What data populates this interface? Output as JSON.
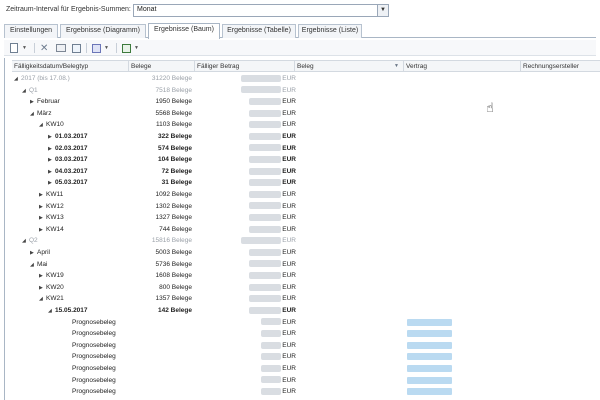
{
  "interval": {
    "label": "Zeitraum-Interval für Ergebnis-Summen:",
    "value": "Monat"
  },
  "tabs": [
    {
      "label": "Einstellungen",
      "active": false
    },
    {
      "label": "Ergebnisse (Diagramm)",
      "active": false
    },
    {
      "label": "Ergebnisse (Baum)",
      "active": true
    },
    {
      "label": "Ergebnisse (Tabelle)",
      "active": false
    },
    {
      "label": "Ergebnisse (Liste)",
      "active": false
    }
  ],
  "toolbar": {
    "icons": [
      "new-document-icon",
      "dropdown-icon",
      "delete-icon",
      "book-icon",
      "page-icon",
      "save-icon",
      "dropdown-icon",
      "export-icon",
      "dropdown-icon"
    ]
  },
  "columns": [
    "Fälligkeitsdatum/Belegtyp",
    "Belege",
    "Fälliger Betrag",
    "Beleg",
    "Vertrag",
    "Rechnungsersteller"
  ],
  "currency": "EUR",
  "rows": [
    {
      "label": "2017 (bis 17.08.)",
      "belege": "31220 Belege",
      "amount": true,
      "level": 0,
      "expanded": true,
      "grey": true
    },
    {
      "label": "Q1",
      "belege": "7518 Belege",
      "amount": true,
      "level": 1,
      "expanded": true,
      "grey": true
    },
    {
      "label": "Februar",
      "belege": "1950 Belege",
      "amount": true,
      "level": 2,
      "expanded": false
    },
    {
      "label": "März",
      "belege": "5568 Belege",
      "amount": true,
      "level": 2,
      "expanded": true
    },
    {
      "label": "KW10",
      "belege": "1103 Belege",
      "amount": true,
      "level": 3,
      "expanded": true
    },
    {
      "label": "01.03.2017",
      "belege": "322 Belege",
      "amount": true,
      "level": 4,
      "expanded": false,
      "bold": true
    },
    {
      "label": "02.03.2017",
      "belege": "574 Belege",
      "amount": true,
      "level": 4,
      "expanded": false,
      "bold": true
    },
    {
      "label": "03.03.2017",
      "belege": "104 Belege",
      "amount": true,
      "level": 4,
      "expanded": false,
      "bold": true
    },
    {
      "label": "04.03.2017",
      "belege": "72 Belege",
      "amount": true,
      "level": 4,
      "expanded": false,
      "bold": true
    },
    {
      "label": "05.03.2017",
      "belege": "31 Belege",
      "amount": true,
      "level": 4,
      "expanded": false,
      "bold": true
    },
    {
      "label": "KW11",
      "belege": "1092 Belege",
      "amount": true,
      "level": 3,
      "expanded": false
    },
    {
      "label": "KW12",
      "belege": "1302 Belege",
      "amount": true,
      "level": 3,
      "expanded": false
    },
    {
      "label": "KW13",
      "belege": "1327 Belege",
      "amount": true,
      "level": 3,
      "expanded": false
    },
    {
      "label": "KW14",
      "belege": "744 Belege",
      "amount": true,
      "level": 3,
      "expanded": false
    },
    {
      "label": "Q2",
      "belege": "15816 Belege",
      "amount": true,
      "level": 1,
      "expanded": true,
      "grey": true
    },
    {
      "label": "April",
      "belege": "5003 Belege",
      "amount": true,
      "level": 2,
      "expanded": false
    },
    {
      "label": "Mai",
      "belege": "5736 Belege",
      "amount": true,
      "level": 2,
      "expanded": true
    },
    {
      "label": "KW19",
      "belege": "1608 Belege",
      "amount": true,
      "level": 3,
      "expanded": false
    },
    {
      "label": "KW20",
      "belege": "800 Belege",
      "amount": true,
      "level": 3,
      "expanded": false
    },
    {
      "label": "KW21",
      "belege": "1357 Belege",
      "amount": true,
      "level": 3,
      "expanded": true
    },
    {
      "label": "15.05.2017",
      "belege": "142 Belege",
      "amount": true,
      "level": 4,
      "expanded": true,
      "bold": true
    },
    {
      "label": "Prognosebeleg",
      "belege": "",
      "amount": true,
      "level": 5,
      "leaf": true,
      "vertrag": true
    },
    {
      "label": "Prognosebeleg",
      "belege": "",
      "amount": true,
      "level": 5,
      "leaf": true,
      "vertrag": true
    },
    {
      "label": "Prognosebeleg",
      "belege": "",
      "amount": true,
      "level": 5,
      "leaf": true,
      "vertrag": true
    },
    {
      "label": "Prognosebeleg",
      "belege": "",
      "amount": true,
      "level": 5,
      "leaf": true,
      "vertrag": true
    },
    {
      "label": "Prognosebeleg",
      "belege": "",
      "amount": true,
      "level": 5,
      "leaf": true,
      "vertrag": true
    },
    {
      "label": "Prognosebeleg",
      "belege": "",
      "amount": true,
      "level": 5,
      "leaf": true,
      "vertrag": true
    },
    {
      "label": "Prognosebeleg",
      "belege": "",
      "amount": true,
      "level": 5,
      "leaf": true,
      "vertrag": true
    }
  ]
}
